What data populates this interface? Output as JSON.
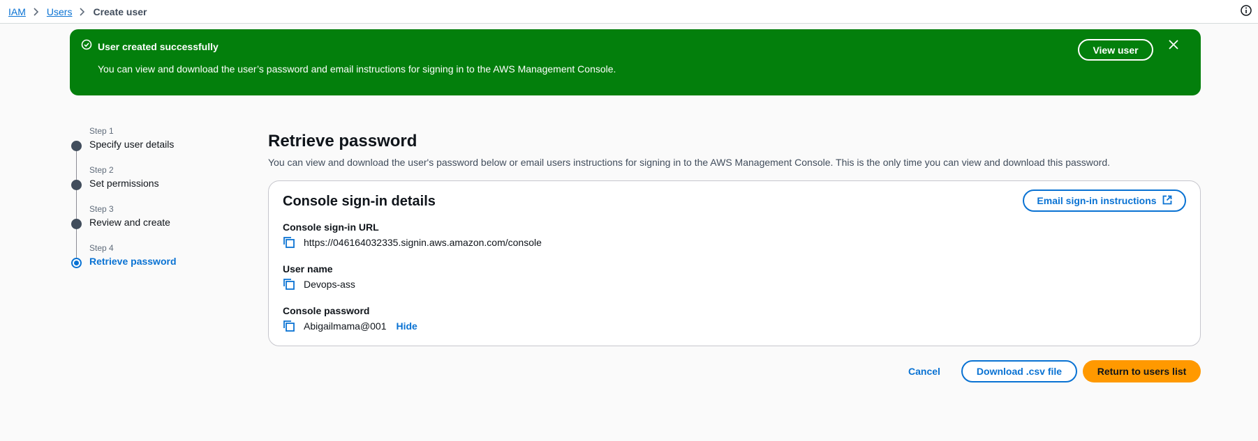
{
  "breadcrumb": {
    "items": [
      {
        "label": "IAM"
      },
      {
        "label": "Users"
      },
      {
        "label": "Create user"
      }
    ]
  },
  "flash": {
    "title": "User created successfully",
    "message": "You can view and download the user’s password and email instructions for signing in to the AWS Management Console.",
    "view_button": "View user",
    "color": "#037f0c"
  },
  "steps": [
    {
      "label": "Step 1",
      "name": "Specify user details"
    },
    {
      "label": "Step 2",
      "name": "Set permissions"
    },
    {
      "label": "Step 3",
      "name": "Review and create"
    },
    {
      "label": "Step 4",
      "name": "Retrieve password"
    }
  ],
  "main": {
    "title": "Retrieve password",
    "description": "You can view and download the user's password below or email users instructions for signing in to the AWS Management Console. This is the only time you can view and download this password."
  },
  "card": {
    "title": "Console sign-in details",
    "email_button": "Email sign-in instructions",
    "fields": [
      {
        "label": "Console sign-in URL",
        "value": "https://046164032335.signin.aws.amazon.com/console"
      },
      {
        "label": "User name",
        "value": "Devops-ass"
      },
      {
        "label": "Console password",
        "value": "Abigailmama@001",
        "action": "Hide"
      }
    ]
  },
  "actions": {
    "cancel": "Cancel",
    "download": "Download .csv file",
    "return": "Return to users list"
  },
  "colors": {
    "accent": "#0972d3",
    "primary_button": "#ff9900",
    "success": "#037f0c"
  }
}
